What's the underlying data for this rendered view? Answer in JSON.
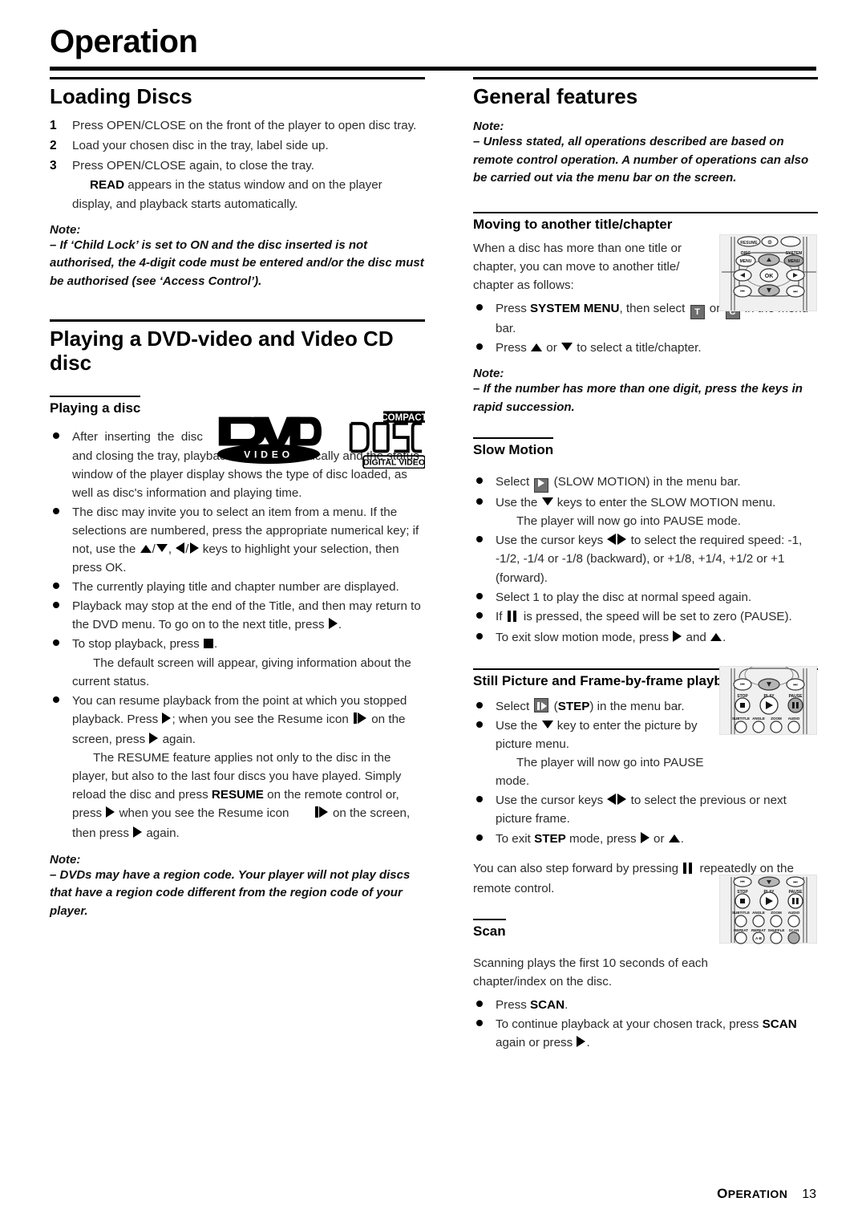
{
  "page": {
    "title": "Operation",
    "footer_section": "Operation",
    "footer_page": "13"
  },
  "left_column": {
    "loading_discs": {
      "heading": "Loading Discs",
      "steps": [
        {
          "num": "1",
          "text": "Press OPEN/CLOSE on the front of the player to open disc tray."
        },
        {
          "num": "2",
          "text": "Load your chosen disc in the tray, label side up."
        },
        {
          "num": "3",
          "text": "Press OPEN/CLOSE again, to close the tray."
        }
      ],
      "step3_sub_bold": "READ",
      "step3_sub_rest": " appears in the status window and on the player display, and playback starts automatically.",
      "note_label": "Note:",
      "note_text": "–  If ‘Child Lock’ is set to ON and the disc inserted is not authorised, the 4-digit code must be entered and/or the disc must be authorised (see ‘Access Control’)."
    },
    "playing_dvd": {
      "heading": "Playing a DVD-video and Video CD disc",
      "subheading": "Playing a disc",
      "logos": [
        {
          "name": "dvd-video-logo",
          "text": "DVD",
          "sub": "VIDEO"
        },
        {
          "name": "compact-disc-digital-video-logo",
          "top": "COMPACT",
          "mid": "disc",
          "bottom": "DIGITAL VIDEO"
        }
      ],
      "bullets": [
        "After inserting the disc and closing the tray, playback starts automatically and the status window of the player display shows the type of disc loaded, as well as disc's information and playing time.",
        "The disc may invite you to select an item from a menu. If the selections are numbered, press the appropriate numerical key; if not, use the ▲/▼, ◀/▶ keys to highlight your selection, then press OK.",
        "The currently playing title and chapter number are displayed.",
        "Playback may stop at the end of the Title, and then may return to the DVD menu. To go on to the next title, press ▶.",
        "To stop playback, press ■.",
        "You can resume playback from the point at which you stopped playback. Press ▶; when you see the Resume icon ▌▶ on the screen, press ▶ again."
      ],
      "stop_sub": "The default screen will appear, giving information about the current status.",
      "resume_para_1": "The RESUME feature applies not only to the disc in the player, but also to the last four discs you have played. Simply reload the disc and press ",
      "resume_bold": "RESUME",
      "resume_para_2": " on the remote control or, press ",
      "resume_para_3": " when you see the Resume icon ",
      "resume_para_4": " on the screen, then press ",
      "resume_para_5": " again.",
      "note_label": "Note:",
      "note_text": "–  DVDs may have a region code. Your player will not play discs that have a region code different from the region code of your player."
    }
  },
  "right_column": {
    "general_features": {
      "heading": "General features",
      "note_label": "Note:",
      "note_text": "–  Unless stated, all operations described are based on remote control operation. A number of operations can also be carried out via the menu bar on the screen."
    },
    "moving_title_chapter": {
      "heading": "Moving to another title/chapter",
      "intro": "When a disc has more than one title or chapter, you can move to another title/ chapter as follows:",
      "bullet1_pre": "Press ",
      "bullet1_bold": "SYSTEM MENU",
      "bullet1_mid": ", then select ",
      "icon_title": "T",
      "bullet1_or": " or ",
      "icon_chapter": "C",
      "bullet1_end": " in the menu bar.",
      "bullet2": "Press ▲ or ▼ to select a title/chapter.",
      "note_label": "Note:",
      "note_text": "–  If the number has more than one digit, press the keys in rapid succession."
    },
    "slow_motion": {
      "heading": "Slow Motion",
      "bullets": [
        "Select ▶ (SLOW MOTION) in the menu bar.",
        "Use the ▼ keys to enter the SLOW MOTION menu.",
        "Use the cursor keys ◀▶ to select the required speed: -1, -1/2, -1/4 or -1/8 (backward), or +1/8, +1/4, +1/2 or +1 (forward).",
        "Select 1 to play the disc at normal speed again.",
        "If ▐▐ is pressed, the speed will be set to zero (PAUSE).",
        "To exit slow motion mode, press ▶ and ▲."
      ],
      "b1_pre": "Select ",
      "b1_post": " (SLOW MOTION) in the menu bar.",
      "b2_pre": "Use the ",
      "b2_post": " keys to enter the SLOW MOTION menu.",
      "b2_sub": "The player will now go into PAUSE mode.",
      "b3_pre": "Use the cursor keys ",
      "b3_post": " to select the required speed: -1, -1/2, -1/4 or -1/8 (backward), or +1/8, +1/4, +1/2 or +1 (forward).",
      "b4": "Select 1 to play the disc at normal speed again.",
      "b5_pre": "If ",
      "b5_post": " is pressed, the speed will be set to zero (PAUSE).",
      "b6_pre": "To exit slow motion mode, press ",
      "b6_mid": " and ",
      "b6_end": "."
    },
    "still_picture": {
      "heading": "Still Picture and Frame-by-frame playback",
      "b1_pre": "Select ",
      "b1_bold": "STEP",
      "b1_post": ") in the menu bar.",
      "b1_open": " (",
      "b2_pre": "Use the ",
      "b2_post": " key to enter the picture by picture menu.",
      "b2_sub": "The player will now go into PAUSE mode.",
      "b3_pre": "Use the cursor keys ",
      "b3_post": " to select the previous or next picture frame.",
      "b4_pre": "To exit ",
      "b4_bold": "STEP",
      "b4_mid": " mode, press ",
      "b4_or": " or ",
      "b4_end": ".",
      "tail_pre": "You can also step forward by pressing ",
      "tail_post": " repeatedly on the remote control."
    },
    "scan": {
      "heading": "Scan",
      "intro": "Scanning plays the first 10 seconds of each chapter/index on the disc.",
      "b1_pre": "Press ",
      "b1_bold": "SCAN",
      "b1_end": ".",
      "b2_pre": "To continue playback at your chosen track, press ",
      "b2_bold": "SCAN",
      "b2_post": " again or press ",
      "b2_end": "."
    }
  },
  "remotes": [
    {
      "name": "remote-navigation-detail",
      "buttons": [
        "RESUME",
        "DISC MENU",
        "SYSTEM MENU",
        "OK"
      ],
      "highlighted": [
        "up-arrow",
        "down-arrow",
        "system-menu"
      ]
    },
    {
      "name": "remote-transport-detail",
      "buttons": [
        "STOP",
        "PLAY",
        "PAUSE",
        "SUBTITLE",
        "ANGLE",
        "ZOOM",
        "AUDIO"
      ],
      "highlighted": [
        "pause",
        "down-arrow"
      ]
    },
    {
      "name": "remote-scan-detail",
      "buttons": [
        "STOP",
        "PLAY",
        "PAUSE",
        "SUBTITLE",
        "ANGLE",
        "ZOOM",
        "AUDIO",
        "REPEAT",
        "REPEAT A-B",
        "SHUFFLE",
        "SCAN"
      ],
      "highlighted": [
        "scan"
      ]
    }
  ]
}
